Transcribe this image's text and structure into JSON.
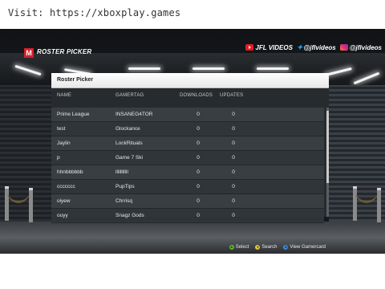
{
  "watermark": {
    "text": "Visit: https://xboxplay.games"
  },
  "header": {
    "logo_letter": "M",
    "screen_title": "ROSTER PICKER",
    "social": [
      {
        "icon": "youtube-icon",
        "label": "JFL VIDEOS"
      },
      {
        "icon": "twitter-icon",
        "label": "@jflvideos"
      },
      {
        "icon": "instagram-icon",
        "label": "@jflvideos"
      }
    ]
  },
  "panel": {
    "title": "Roster Picker",
    "columns": {
      "name": "NAME",
      "gamertag": "GAMERTAG",
      "downloads": "DOWNLOADS",
      "updates": "UPDATES"
    },
    "rows": [
      {
        "name": "Prime League",
        "gamertag": "INSANEG4TOR",
        "downloads": "0",
        "updates": "0"
      },
      {
        "name": "test",
        "gamertag": "Glockance",
        "downloads": "0",
        "updates": "0"
      },
      {
        "name": "Jaylin",
        "gamertag": "LockRituals",
        "downloads": "0",
        "updates": "0"
      },
      {
        "name": "p",
        "gamertag": "Game 7 Ski",
        "downloads": "0",
        "updates": "0"
      },
      {
        "name": "hhnbbbbbb",
        "gamertag": "lllllllllll",
        "downloads": "0",
        "updates": "0"
      },
      {
        "name": "ccccccc",
        "gamertag": "PupTips",
        "downloads": "0",
        "updates": "0"
      },
      {
        "name": "oiyew",
        "gamertag": "Chrrisq",
        "downloads": "0",
        "updates": "0"
      },
      {
        "name": "ouyy",
        "gamertag": "Snagz Gods",
        "downloads": "0",
        "updates": "0"
      }
    ],
    "hints": [
      {
        "button": "A",
        "label": "Select"
      },
      {
        "button": "Y",
        "label": "Search"
      },
      {
        "button": "X",
        "label": "View Gamercard"
      }
    ]
  },
  "colors": {
    "logo_red": "#d4202a",
    "button_a": "#5cb82e",
    "button_y": "#e0c23a",
    "button_x": "#3b8ad9"
  }
}
